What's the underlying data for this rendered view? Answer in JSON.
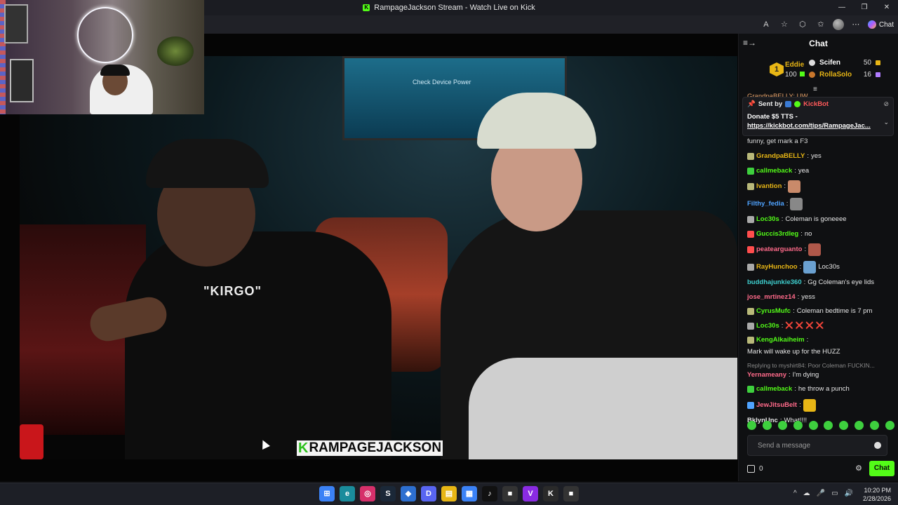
{
  "browser": {
    "title": "RampageJackson Stream - Watch Live on Kick",
    "chat_button": "Chat",
    "window_controls": [
      "—",
      "❐",
      "✕"
    ],
    "toolbar_icons": [
      "A",
      "☆",
      "⬡",
      "✩",
      "⋯"
    ]
  },
  "video": {
    "overlay_name": "RAMPAGEJACKSON",
    "overlay_k": "K",
    "shirt_text": "\"KIRGO\"",
    "screen_text": "Check Device Power"
  },
  "chat": {
    "header": "Chat",
    "collapse_icon": "≡→",
    "leaderboard": {
      "rank1": {
        "rank": "1",
        "name": "Eddie",
        "value": "100"
      },
      "rank2": {
        "name": "Scifen",
        "value": "50"
      },
      "rank3": {
        "name": "RollaSolo",
        "value": "16"
      }
    },
    "scroll_indicator": "≡",
    "partial_top": "GrandpaBELLY: UW",
    "pinned": {
      "sent_by": "Sent by",
      "sender": "KickBot",
      "line1": "Donate $5 TTS -",
      "link": "https://kickbot.com/tips/RampageJac..."
    },
    "partial_mid": "funny, get mark a F3",
    "messages": [
      {
        "user": "GrandpaBELLY",
        "color": "#e8b615",
        "badge": "#b9b97a",
        "text": "yes"
      },
      {
        "user": "callmeback",
        "color": "#53fc18",
        "badge": "#3ecf3e",
        "text": "yea"
      },
      {
        "user": "Ivantion",
        "color": "#e8b615",
        "badge": "#b9b97a",
        "text": "",
        "emote": "#c98a6a"
      },
      {
        "user": "Filthy_fedia",
        "color": "#4fa3ff",
        "badge": "",
        "text": "",
        "emote": "#888888"
      },
      {
        "user": "Loc30s",
        "color": "#53fc18",
        "badge": "#aaaaaa",
        "text": "Coleman is goneeee"
      },
      {
        "user": "Guccis3rdleg",
        "color": "#53fc18",
        "badge": "#ff4d4d",
        "text": "no"
      },
      {
        "user": "peatearguanto",
        "color": "#ff6a8a",
        "badge": "#ff4d4d",
        "text": "",
        "emote": "#b0584a"
      },
      {
        "user": "RayHunchoo",
        "color": "#e8b615",
        "badge": "#aaaaaa",
        "text": "Loc30s",
        "emote": "#6aa0d0"
      },
      {
        "user": "buddhajunkie360",
        "color": "#3ecfcf",
        "badge": "",
        "text": "Gg Coleman's eye lids"
      },
      {
        "user": "jose_mrtinez14",
        "color": "#ff6a8a",
        "badge": "",
        "text": "yess"
      },
      {
        "user": "CyrusMufc",
        "color": "#53fc18",
        "badge": "#b9b97a",
        "text": "Coleman bedtime is 7 pm"
      },
      {
        "user": "Loc30s",
        "color": "#53fc18",
        "badge": "#aaaaaa",
        "text": "❌ ❌ ❌ ❌"
      },
      {
        "user": "KengAlkaiheim",
        "color": "#53fc18",
        "badge": "#b9b97a",
        "text": "Mark will wake up for the HUZZ"
      },
      {
        "reply": "Replying to myshirt84: Poor Coleman FUCKIN...",
        "user": "Yernameany",
        "color": "#ff6a8a",
        "badge": "",
        "text": "I'm dying"
      },
      {
        "user": "callmeback",
        "color": "#53fc18",
        "badge": "#3ecf3e",
        "text": "he throw a punch"
      },
      {
        "user": "JewJitsuBelt",
        "color": "#ff6a8a",
        "badge": "#4fa3ff",
        "text": "",
        "emote": "#e8b615"
      },
      {
        "user": "BklynUnc",
        "color": "#e6e6e6",
        "badge": "",
        "text": "What!!!!"
      }
    ],
    "input_placeholder": "Send a message",
    "points": "0",
    "send_label": "Chat"
  },
  "taskbar": {
    "apps": [
      {
        "name": "windows-start",
        "label": "⊞",
        "color": "#3b82f6"
      },
      {
        "name": "edge",
        "label": "e",
        "color": "#1a8c9c"
      },
      {
        "name": "instagram",
        "label": "◎",
        "color": "#d6306a"
      },
      {
        "name": "steam",
        "label": "S",
        "color": "#1b2838"
      },
      {
        "name": "app-blue",
        "label": "◆",
        "color": "#2d6fd0"
      },
      {
        "name": "discord",
        "label": "D",
        "color": "#5865f2"
      },
      {
        "name": "explorer",
        "label": "▤",
        "color": "#e8b615"
      },
      {
        "name": "store",
        "label": "▦",
        "color": "#3b82f6"
      },
      {
        "name": "tiktok",
        "label": "♪",
        "color": "#111111"
      },
      {
        "name": "app-dark",
        "label": "■",
        "color": "#333333"
      },
      {
        "name": "vimeo",
        "label": "V",
        "color": "#8a2be2"
      },
      {
        "name": "kick",
        "label": "K",
        "color": "#2a2a2a"
      },
      {
        "name": "app-dark2",
        "label": "■",
        "color": "#333333"
      }
    ],
    "tray": [
      "^",
      "☁",
      "🎤",
      "▭",
      "🔊"
    ],
    "time": "10:20 PM",
    "date": "2/28/2026"
  }
}
